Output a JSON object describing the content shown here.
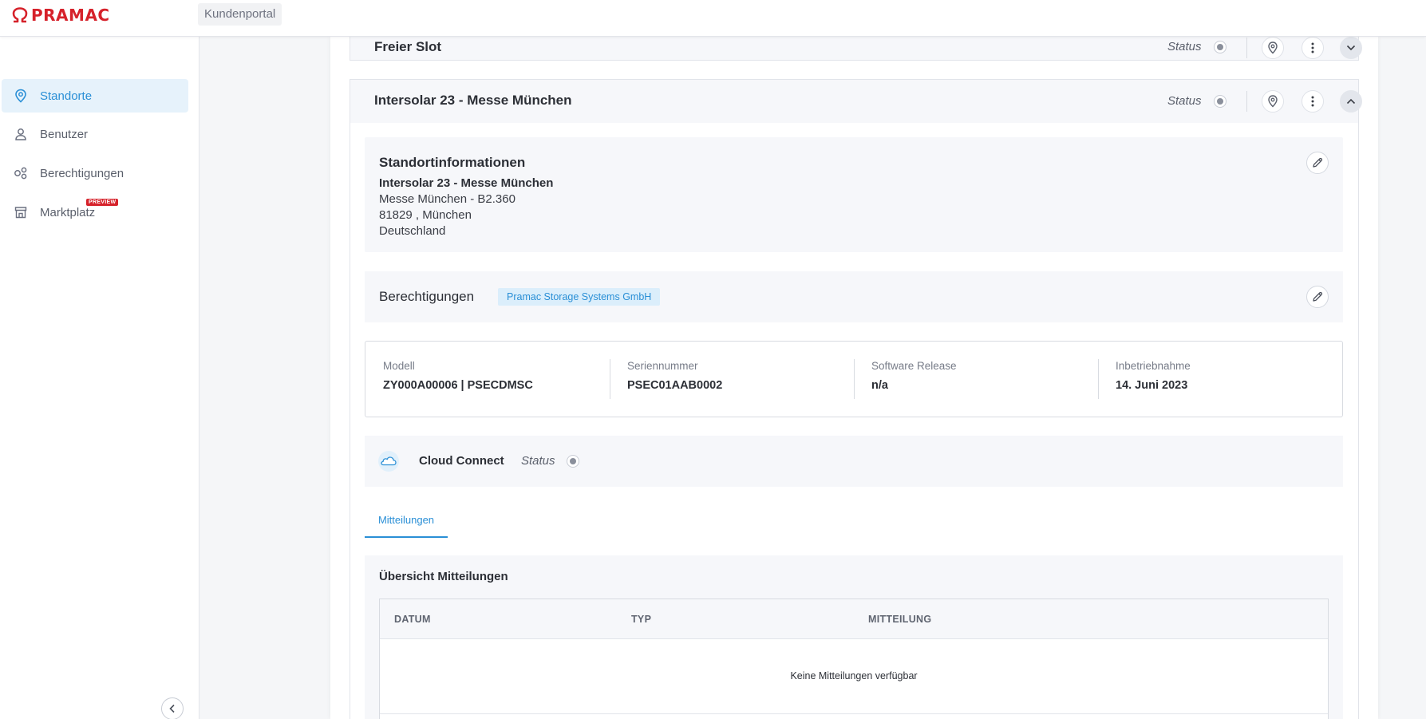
{
  "app": {
    "brand": "PRAMAC",
    "portal_label": "Kundenportal"
  },
  "sidebar": {
    "items": [
      {
        "label": "Standorte",
        "icon": "location-pin-icon",
        "active": true
      },
      {
        "label": "Benutzer",
        "icon": "user-icon",
        "active": false
      },
      {
        "label": "Berechtigungen",
        "icon": "permissions-icon",
        "active": false
      },
      {
        "label": "Marktplatz",
        "icon": "store-icon",
        "active": false,
        "badge": "PREVIEW"
      }
    ]
  },
  "locations": [
    {
      "title": "Freier Slot",
      "status_label": "Status",
      "expanded": false
    },
    {
      "title": "Intersolar 23 - Messe München",
      "status_label": "Status",
      "expanded": true
    }
  ],
  "location_info": {
    "title": "Standortinformationen",
    "name": "Intersolar 23 - Messe München",
    "address_line": "Messe München - B2.360",
    "city_line": "81829 , München",
    "country": "Deutschland"
  },
  "permissions": {
    "title": "Berechtigungen",
    "company": "Pramac Storage Systems GmbH"
  },
  "device": {
    "fields": [
      {
        "label": "Modell",
        "value": "ZY000A00006 | PSECDMSC"
      },
      {
        "label": "Seriennummer",
        "value": "PSEC01AAB0002"
      },
      {
        "label": "Software Release",
        "value": "n/a"
      },
      {
        "label": "Inbetriebnahme",
        "value": "14. Juni 2023"
      }
    ]
  },
  "cloud": {
    "title": "Cloud Connect",
    "status_label": "Status"
  },
  "tabs": {
    "active": "Mitteilungen"
  },
  "messages": {
    "title": "Übersicht Mitteilungen",
    "columns": [
      "DATUM",
      "TYP",
      "MITTEILUNG"
    ],
    "empty_text": "Keine Mitteilungen verfügbar"
  },
  "colors": {
    "brand": "#d6222b",
    "accent": "#2a8fd6"
  }
}
